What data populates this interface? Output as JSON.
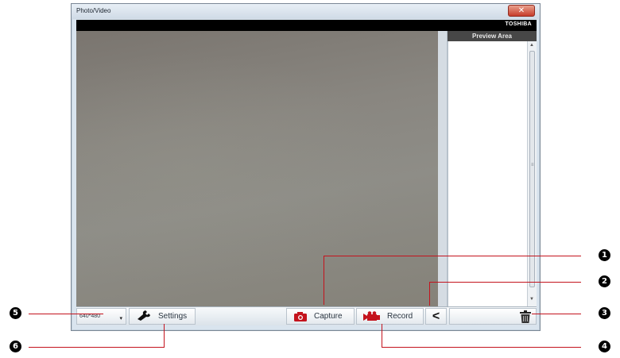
{
  "window": {
    "title": "Photo/Video",
    "close_glyph": "✕",
    "brand": "TOSHIBA"
  },
  "side_panel": {
    "header": "Preview Area",
    "scroll_up": "▲",
    "scroll_down": "▼",
    "grip": "≡"
  },
  "toolbar": {
    "resolution": "640*480",
    "resolution_caret": "▾",
    "settings_label": "Settings",
    "settings_icon": "wrench-icon",
    "capture_label": "Capture",
    "capture_icon": "camera-icon",
    "record_label": "Record",
    "record_icon": "video-camera-icon",
    "collapse_glyph": "<",
    "delete_icon": "trash-icon"
  },
  "callouts": [
    "1",
    "2",
    "3",
    "4",
    "5",
    "6"
  ],
  "colors": {
    "callout_line": "#c4131d",
    "brand_bar": "#000000",
    "icon_red": "#c4131d"
  }
}
